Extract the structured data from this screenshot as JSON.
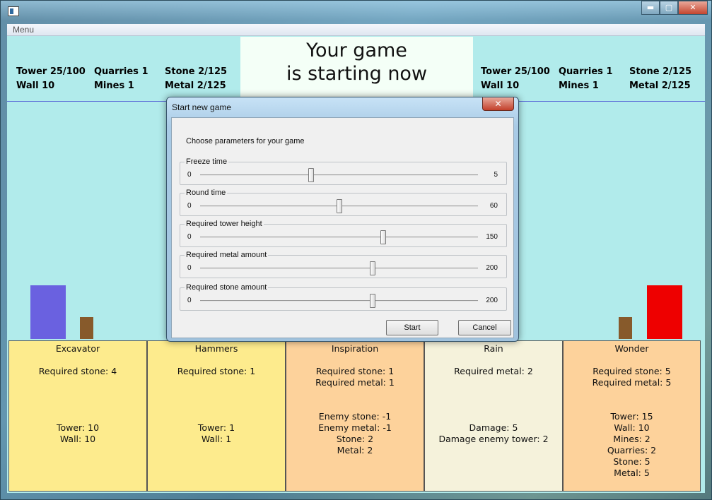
{
  "window": {
    "minimize": "▬",
    "maximize": "▢",
    "close": "✕"
  },
  "menu": {
    "label": "Menu"
  },
  "left_stats": {
    "tower": "Tower 25/100",
    "wall": "Wall 10",
    "quarries": "Quarries 1",
    "mines": "Mines 1",
    "stone": "Stone 2/125",
    "metal": "Metal 2/125"
  },
  "right_stats": {
    "tower": "Tower 25/100",
    "wall": "Wall 10",
    "quarries": "Quarries 1",
    "mines": "Mines 1",
    "stone": "Stone 2/125",
    "metal": "Metal 2/125"
  },
  "status": {
    "line1": "Your game",
    "line2": "is starting now"
  },
  "colors": {
    "player_tower": "#6a61e0",
    "player_wall": "#875a2b",
    "enemy_tower": "#ee0000",
    "enemy_wall": "#875a2b",
    "card_yellow": "#fdeb8d",
    "card_orange": "#fdd29b",
    "card_cream": "#f5f2db"
  },
  "cards": [
    {
      "title": "Excavator",
      "requires": [
        "Required stone: 4"
      ],
      "effects": [
        "Tower: 10",
        "Wall: 10"
      ]
    },
    {
      "title": "Hammers",
      "requires": [
        "Required stone: 1"
      ],
      "effects": [
        "Tower: 1",
        "Wall: 1"
      ]
    },
    {
      "title": "Inspiration",
      "requires": [
        "Required stone: 1",
        "Required metal: 1"
      ],
      "effects": [
        "Enemy stone: -1",
        "Enemy metal: -1",
        "Stone: 2",
        "Metal: 2"
      ]
    },
    {
      "title": "Rain",
      "requires": [
        "Required metal: 2"
      ],
      "effects": [
        "Damage: 5",
        "Damage enemy tower: 2"
      ]
    },
    {
      "title": "Wonder",
      "requires": [
        "Required stone: 5",
        "Required metal: 5"
      ],
      "effects": [
        "Tower: 15",
        "Wall: 10",
        "Mines: 2",
        "Quarries: 2",
        "Stone: 5",
        "Metal: 5"
      ]
    }
  ],
  "dialog": {
    "title": "Start new game",
    "close": "✕",
    "intro": "Choose parameters for your game",
    "sliders": [
      {
        "label": "Freeze time",
        "min": "0",
        "max": "5",
        "fraction": 0.4
      },
      {
        "label": "Round time",
        "min": "0",
        "max": "60",
        "fraction": 0.5
      },
      {
        "label": "Required tower height",
        "min": "0",
        "max": "150",
        "fraction": 0.66
      },
      {
        "label": "Required metal amount",
        "min": "0",
        "max": "200",
        "fraction": 0.62
      },
      {
        "label": "Required stone amount",
        "min": "0",
        "max": "200",
        "fraction": 0.62
      }
    ],
    "start_label": "Start",
    "cancel_label": "Cancel"
  }
}
